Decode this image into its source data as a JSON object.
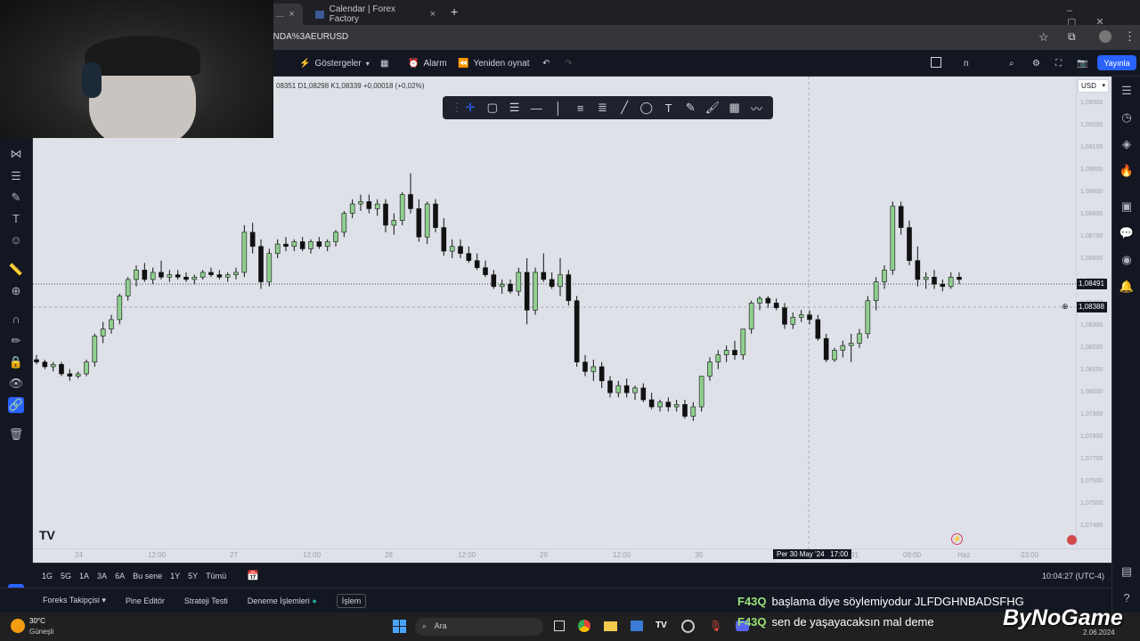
{
  "browser": {
    "tabs": [
      {
        "label": "...",
        "close": "×"
      },
      {
        "label": "Calendar | Forex Factory",
        "close": "×"
      }
    ],
    "new_tab": "+",
    "url": "ANDA%3AEURUSD"
  },
  "toolbar": {
    "indicators": "Göstergeler",
    "alarm": "Alarm",
    "replay": "Yeniden oynat",
    "publish": "Yayınla",
    "interval": "n"
  },
  "ohlc": "08351 D1,08298 K1,08339 +0,00018 (+0,02%)",
  "currency": "USD",
  "price_axis": [
    "1,09300",
    "1,09200",
    "1,09100",
    "1,09000",
    "1,08900",
    "1,08800",
    "1,08700",
    "1,08600",
    "1,08500",
    "1,08400",
    "1,08300",
    "1,08200",
    "1,08100",
    "1,08000",
    "1,07900",
    "1,07800",
    "1,07700",
    "1,07600",
    "1,07500",
    "1,07400"
  ],
  "price_badges": {
    "last": "1,08491",
    "crosshair": "1,08388"
  },
  "time_axis": [
    "24",
    "12:00",
    "27",
    "12:00",
    "28",
    "12:00",
    "29",
    "12:00",
    "30",
    "Per 30 May '24   17:00",
    "31",
    "09:00",
    "Haz",
    "03:00"
  ],
  "range_buttons": [
    "1G",
    "5G",
    "1A",
    "3A",
    "6A",
    "Bu sene",
    "1Y",
    "5Y",
    "Tümü"
  ],
  "clock": "10:04:27 (UTC-4)",
  "bottom_tabs": [
    "Foreks Takipçisi",
    "Pine Editör",
    "Strateji Testi",
    "Deneme İşlemleri",
    "İşlem"
  ],
  "chat": [
    {
      "user": "F43Q",
      "msg": "başlama diye söylemiyodur JLFDGHNBADSFHG"
    },
    {
      "user": "F43Q",
      "msg": "sen de yaşayacaksın mal deme"
    }
  ],
  "overlay_logo": "ByNoGame",
  "taskbar": {
    "weather_temp": "30°C",
    "weather_label": "Güneşli",
    "search": "Ara",
    "date": "2.06.2024"
  },
  "chart_data": {
    "type": "candlestick",
    "symbol": "EURUSD",
    "ylim": [
      1.0735,
      1.0935
    ],
    "candles": [
      [
        1.0815,
        1.0817,
        1.0813,
        1.0814
      ],
      [
        1.0814,
        1.0815,
        1.0811,
        1.0812
      ],
      [
        1.0812,
        1.0814,
        1.081,
        1.0813
      ],
      [
        1.0813,
        1.0814,
        1.0808,
        1.0809
      ],
      [
        1.0809,
        1.0811,
        1.0806,
        1.0808
      ],
      [
        1.0808,
        1.081,
        1.0807,
        1.0809
      ],
      [
        1.0809,
        1.0815,
        1.0808,
        1.0814
      ],
      [
        1.0814,
        1.0826,
        1.0812,
        1.0825
      ],
      [
        1.0825,
        1.0831,
        1.0822,
        1.0828
      ],
      [
        1.0828,
        1.0834,
        1.0826,
        1.0832
      ],
      [
        1.0832,
        1.0843,
        1.083,
        1.0842
      ],
      [
        1.0842,
        1.085,
        1.084,
        1.0849
      ],
      [
        1.0849,
        1.0855,
        1.0846,
        1.0853
      ],
      [
        1.0853,
        1.0856,
        1.0848,
        1.0849
      ],
      [
        1.0849,
        1.0854,
        1.0847,
        1.0852
      ],
      [
        1.0852,
        1.0857,
        1.0849,
        1.085
      ],
      [
        1.085,
        1.0853,
        1.0848,
        1.0851
      ],
      [
        1.0851,
        1.0853,
        1.0849,
        1.085
      ],
      [
        1.085,
        1.0852,
        1.0848,
        1.0849
      ],
      [
        1.0849,
        1.0851,
        1.0847,
        1.085
      ],
      [
        1.085,
        1.0853,
        1.0849,
        1.0852
      ],
      [
        1.0852,
        1.0854,
        1.085,
        1.0851
      ],
      [
        1.0851,
        1.0853,
        1.0849,
        1.085
      ],
      [
        1.085,
        1.0852,
        1.0848,
        1.0851
      ],
      [
        1.0851,
        1.0854,
        1.0849,
        1.0852
      ],
      [
        1.0852,
        1.0872,
        1.085,
        1.0869
      ],
      [
        1.0869,
        1.0873,
        1.086,
        1.0863
      ],
      [
        1.0863,
        1.0866,
        1.0845,
        1.0848
      ],
      [
        1.0848,
        1.0862,
        1.0846,
        1.086
      ],
      [
        1.086,
        1.0866,
        1.0858,
        1.0864
      ],
      [
        1.0864,
        1.0867,
        1.0861,
        1.0863
      ],
      [
        1.0863,
        1.0866,
        1.0861,
        1.0865
      ],
      [
        1.0865,
        1.0867,
        1.0861,
        1.0862
      ],
      [
        1.0862,
        1.0866,
        1.086,
        1.0865
      ],
      [
        1.0865,
        1.0867,
        1.0862,
        1.0863
      ],
      [
        1.0863,
        1.0866,
        1.0861,
        1.0865
      ],
      [
        1.0865,
        1.087,
        1.0863,
        1.0869
      ],
      [
        1.0869,
        1.0878,
        1.0867,
        1.0877
      ],
      [
        1.0877,
        1.0883,
        1.0875,
        1.0881
      ],
      [
        1.0881,
        1.0885,
        1.0878,
        1.0882
      ],
      [
        1.0882,
        1.0885,
        1.0877,
        1.0879
      ],
      [
        1.0879,
        1.0883,
        1.0876,
        1.0881
      ],
      [
        1.0881,
        1.0883,
        1.0869,
        1.0872
      ],
      [
        1.0872,
        1.0877,
        1.0868,
        1.0874
      ],
      [
        1.0874,
        1.0886,
        1.0872,
        1.0885
      ],
      [
        1.0885,
        1.0894,
        1.0877,
        1.0879
      ],
      [
        1.0879,
        1.0883,
        1.0865,
        1.0867
      ],
      [
        1.0867,
        1.0882,
        1.0864,
        1.0881
      ],
      [
        1.0881,
        1.0883,
        1.0869,
        1.0871
      ],
      [
        1.0871,
        1.0875,
        1.0859,
        1.0861
      ],
      [
        1.0861,
        1.0866,
        1.0858,
        1.0863
      ],
      [
        1.0863,
        1.0866,
        1.0858,
        1.086
      ],
      [
        1.086,
        1.0863,
        1.0856,
        1.0857
      ],
      [
        1.0857,
        1.086,
        1.0853,
        1.0854
      ],
      [
        1.0854,
        1.0857,
        1.085,
        1.0851
      ],
      [
        1.0851,
        1.0853,
        1.0845,
        1.0846
      ],
      [
        1.0846,
        1.0849,
        1.0843,
        1.0847
      ],
      [
        1.0847,
        1.0849,
        1.0843,
        1.0844
      ],
      [
        1.0844,
        1.0854,
        1.0842,
        1.0852
      ],
      [
        1.0852,
        1.0858,
        1.083,
        1.0836
      ],
      [
        1.0836,
        1.0854,
        1.0834,
        1.0852
      ],
      [
        1.0852,
        1.086,
        1.0848,
        1.0849
      ],
      [
        1.0849,
        1.0852,
        1.0845,
        1.0846
      ],
      [
        1.0846,
        1.0858,
        1.0842,
        1.0851
      ],
      [
        1.0851,
        1.0853,
        1.0838,
        1.084
      ],
      [
        1.084,
        1.0842,
        1.0812,
        1.0814
      ],
      [
        1.0814,
        1.0817,
        1.0808,
        1.081
      ],
      [
        1.081,
        1.0815,
        1.0806,
        1.0812
      ],
      [
        1.0812,
        1.0814,
        1.0803,
        1.0806
      ],
      [
        1.0806,
        1.0808,
        1.0799,
        1.0801
      ],
      [
        1.0801,
        1.0806,
        1.0799,
        1.0804
      ],
      [
        1.0804,
        1.0807,
        1.0799,
        1.0801
      ],
      [
        1.0801,
        1.0804,
        1.0798,
        1.0803
      ],
      [
        1.0803,
        1.0805,
        1.0797,
        1.0798
      ],
      [
        1.0798,
        1.0801,
        1.0794,
        1.0795
      ],
      [
        1.0795,
        1.0798,
        1.0793,
        1.0797
      ],
      [
        1.0797,
        1.0799,
        1.0793,
        1.0795
      ],
      [
        1.0795,
        1.0798,
        1.0793,
        1.0796
      ],
      [
        1.0796,
        1.0798,
        1.079,
        1.0791
      ],
      [
        1.0791,
        1.0797,
        1.0789,
        1.0795
      ],
      [
        1.0795,
        1.0808,
        1.0793,
        1.0808
      ],
      [
        1.0808,
        1.0816,
        1.0806,
        1.0814
      ],
      [
        1.0814,
        1.0819,
        1.0811,
        1.0817
      ],
      [
        1.0817,
        1.0821,
        1.0814,
        1.0819
      ],
      [
        1.0819,
        1.0823,
        1.0815,
        1.0817
      ],
      [
        1.0817,
        1.0828,
        1.0815,
        1.0828
      ],
      [
        1.0828,
        1.084,
        1.0826,
        1.0839
      ],
      [
        1.0839,
        1.0842,
        1.0836,
        1.0841
      ],
      [
        1.0841,
        1.0842,
        1.0837,
        1.0839
      ],
      [
        1.0839,
        1.0841,
        1.0836,
        1.0837
      ],
      [
        1.0837,
        1.0839,
        1.0828,
        1.083
      ],
      [
        1.083,
        1.0835,
        1.0828,
        1.0833
      ],
      [
        1.0833,
        1.0836,
        1.0831,
        1.0834
      ],
      [
        1.0834,
        1.0836,
        1.083,
        1.0832
      ],
      [
        1.0832,
        1.0834,
        1.0823,
        1.0824
      ],
      [
        1.0824,
        1.0826,
        1.0814,
        1.0815
      ],
      [
        1.0815,
        1.082,
        1.0814,
        1.0819
      ],
      [
        1.0819,
        1.0823,
        1.0816,
        1.0821
      ],
      [
        1.0821,
        1.0826,
        1.0814,
        1.0822
      ],
      [
        1.0822,
        1.0828,
        1.082,
        1.0826
      ],
      [
        1.0826,
        1.0842,
        1.0824,
        1.084
      ],
      [
        1.084,
        1.085,
        1.0836,
        1.0848
      ],
      [
        1.0848,
        1.0855,
        1.0845,
        1.0853
      ],
      [
        1.0853,
        1.0882,
        1.0851,
        1.088
      ],
      [
        1.088,
        1.0882,
        1.0868,
        1.0871
      ],
      [
        1.0871,
        1.0874,
        1.0855,
        1.0857
      ],
      [
        1.0857,
        1.0863,
        1.0846,
        1.0849
      ],
      [
        1.0849,
        1.0852,
        1.0845,
        1.085
      ],
      [
        1.085,
        1.0853,
        1.0845,
        1.0847
      ],
      [
        1.0847,
        1.0849,
        1.0844,
        1.0846
      ],
      [
        1.0846,
        1.0852,
        1.0845,
        1.085
      ],
      [
        1.085,
        1.0852,
        1.0847,
        1.0849
      ]
    ]
  }
}
